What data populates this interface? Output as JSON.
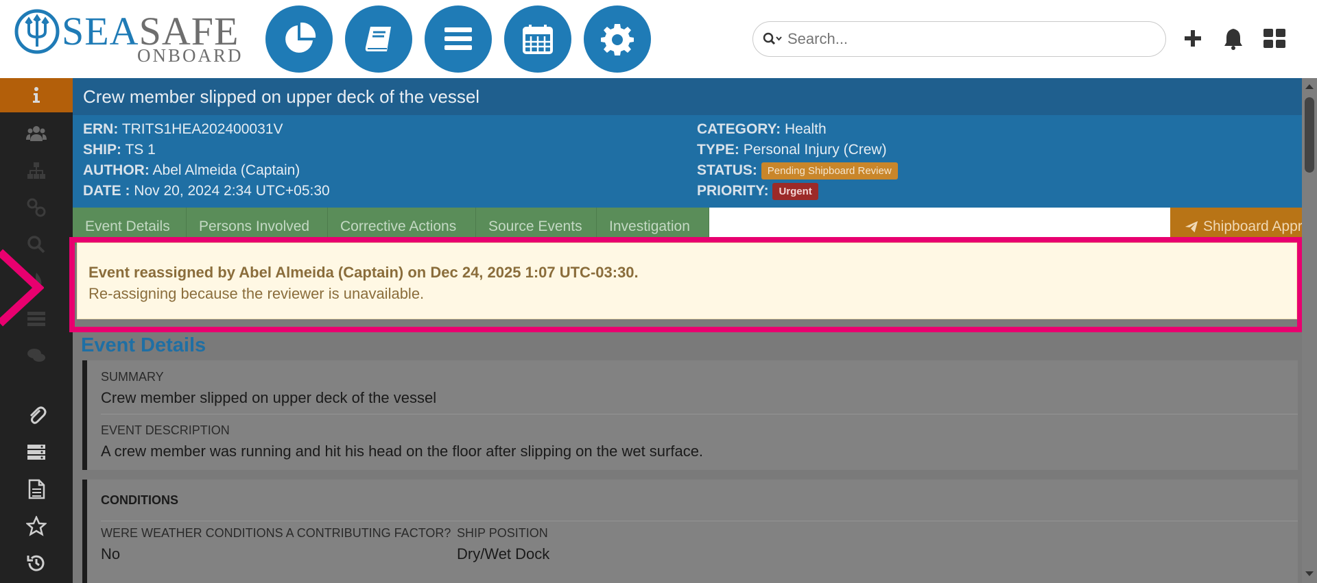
{
  "header": {
    "logo_main": "SEA",
    "logo_accent": "SAFE",
    "logo_sub": "ONBOARD",
    "nav": [
      {
        "icon": "pie-chart-icon"
      },
      {
        "icon": "book-icon"
      },
      {
        "icon": "menu-icon"
      },
      {
        "icon": "calendar-icon"
      },
      {
        "icon": "gear-icon"
      }
    ],
    "search_placeholder": "Search...",
    "tools": [
      "plus-icon",
      "bell-icon",
      "grid-icon"
    ]
  },
  "sidebar": {
    "items": [
      "info-icon",
      "users-icon",
      "org-chart-icon",
      "link-icon",
      "search-icon",
      "flame-icon",
      "list-icon",
      "comments-icon",
      "paperclip-icon",
      "stack-icon",
      "document-icon",
      "star-icon",
      "history-icon"
    ]
  },
  "event": {
    "title": "Crew member slipped on upper deck of the vessel",
    "fields_left": [
      {
        "label": "ERN:",
        "value": "TRITS1HEA202400031V"
      },
      {
        "label": "SHIP:",
        "value": "TS 1"
      },
      {
        "label": "AUTHOR:",
        "value": "Abel Almeida (Captain)"
      },
      {
        "label": "DATE :",
        "value": "Nov 20, 2024 2:34 UTC+05:30"
      }
    ],
    "fields_right": [
      {
        "label": "CATEGORY:",
        "value": "Health"
      },
      {
        "label": "TYPE:",
        "value": "Personal Injury (Crew)"
      },
      {
        "label": "STATUS:",
        "value": "Pending Shipboard Review"
      },
      {
        "label": "PRIORITY:",
        "value": "Urgent"
      }
    ]
  },
  "tabs": [
    {
      "label": "Event Details"
    },
    {
      "label": "Persons Involved"
    },
    {
      "label": "Corrective Actions"
    },
    {
      "label": "Source Events"
    },
    {
      "label": "Investigation"
    }
  ],
  "approval_button": "Shipboard Approval",
  "notice": {
    "title": "Event reassigned by Abel Almeida (Captain) on Dec 24, 2025 1:07 UTC-03:30.",
    "message": "Re-assigning because the reviewer is unavailable."
  },
  "details": {
    "section_title": "Event Details",
    "summary_label": "SUMMARY",
    "summary_value": "Crew member slipped on upper deck of the vessel",
    "description_label": "EVENT DESCRIPTION",
    "description_value": "A crew member was running and hit his head on the floor after slipping on the wet surface.",
    "conditions_title": "CONDITIONS",
    "weather_label": "WERE WEATHER CONDITIONS A CONTRIBUTING FACTOR?",
    "weather_value": "No",
    "position_label": "SHIP POSITION",
    "position_value": "Dry/Wet Dock"
  },
  "colors": {
    "brand_blue": "#1f7bb6",
    "highlight": "#e8006f",
    "sidebar_active": "#b35f0a",
    "tab_green": "#5a8d59",
    "approval_orange": "#b87416"
  }
}
